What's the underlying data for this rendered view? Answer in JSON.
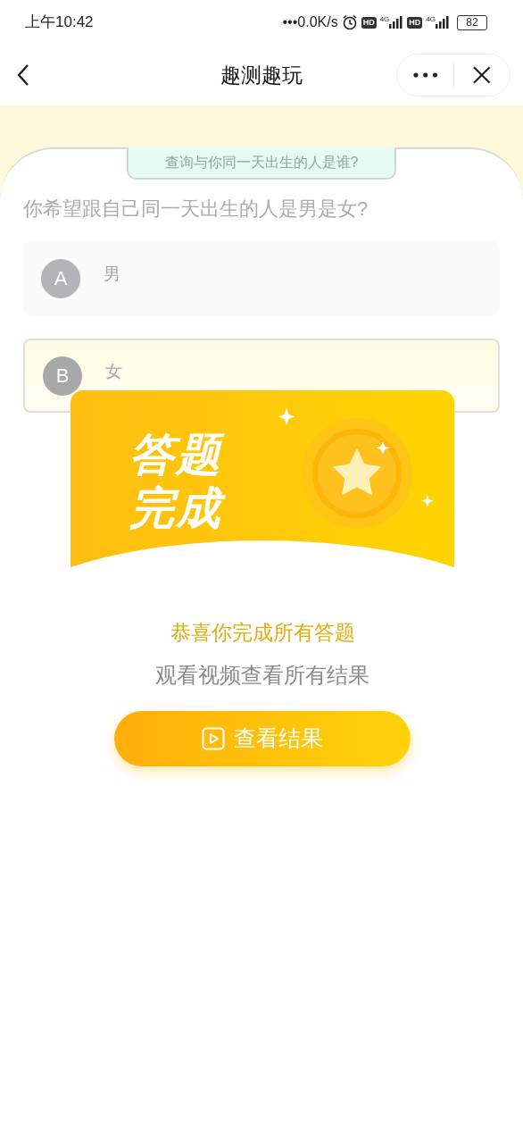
{
  "status_bar": {
    "time": "上午10:42",
    "network_speed": "•••0.0K/s",
    "sims": [
      {
        "badge": "HD",
        "network": "4G"
      },
      {
        "badge": "HD",
        "network": "4G"
      }
    ],
    "battery": "82"
  },
  "nav": {
    "title": "趣测趣玩"
  },
  "quiz": {
    "tag": "查询与你同一天出生的人是谁?",
    "question": "你希望跟自己同一天出生的人是男是女?",
    "options": [
      {
        "letter": "A",
        "text": "男",
        "selected": false
      },
      {
        "letter": "B",
        "text": "女",
        "selected": true
      }
    ]
  },
  "modal": {
    "heading_lines": [
      "答题",
      "完成"
    ],
    "message": "恭喜你完成所有答题",
    "submessage": "观看视频查看所有结果",
    "button": "查看结果"
  }
}
